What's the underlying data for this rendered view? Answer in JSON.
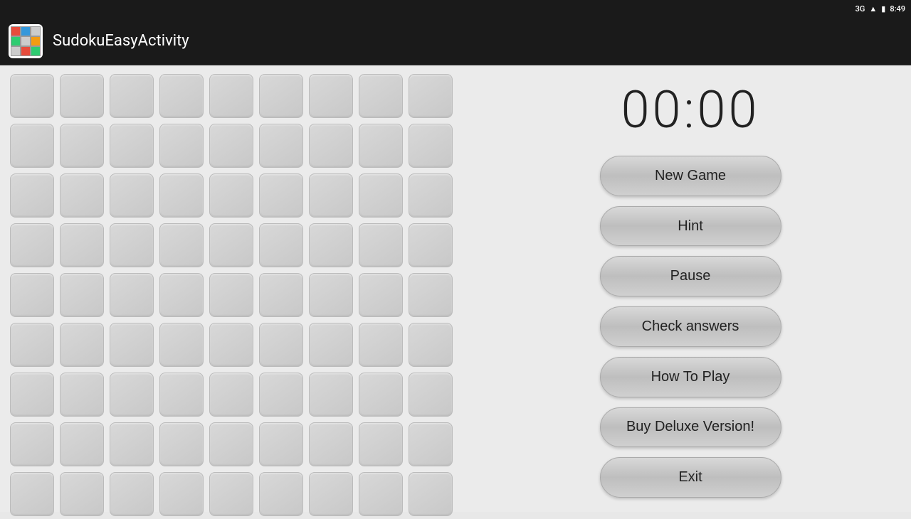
{
  "statusBar": {
    "signal": "3G",
    "signalBars": "▲",
    "battery": "🔋",
    "time": "8:49"
  },
  "appBar": {
    "title": "SudokuEasyActivity"
  },
  "timer": "00:00",
  "buttons": [
    {
      "id": "new-game",
      "label": "New Game"
    },
    {
      "id": "hint",
      "label": "Hint"
    },
    {
      "id": "pause",
      "label": "Pause"
    },
    {
      "id": "check-answers",
      "label": "Check answers"
    },
    {
      "id": "how-to-play",
      "label": "How To Play"
    },
    {
      "id": "buy-deluxe",
      "label": "Buy Deluxe Version!"
    },
    {
      "id": "exit",
      "label": "Exit"
    }
  ],
  "grid": {
    "rows": 9,
    "cols": 9
  }
}
